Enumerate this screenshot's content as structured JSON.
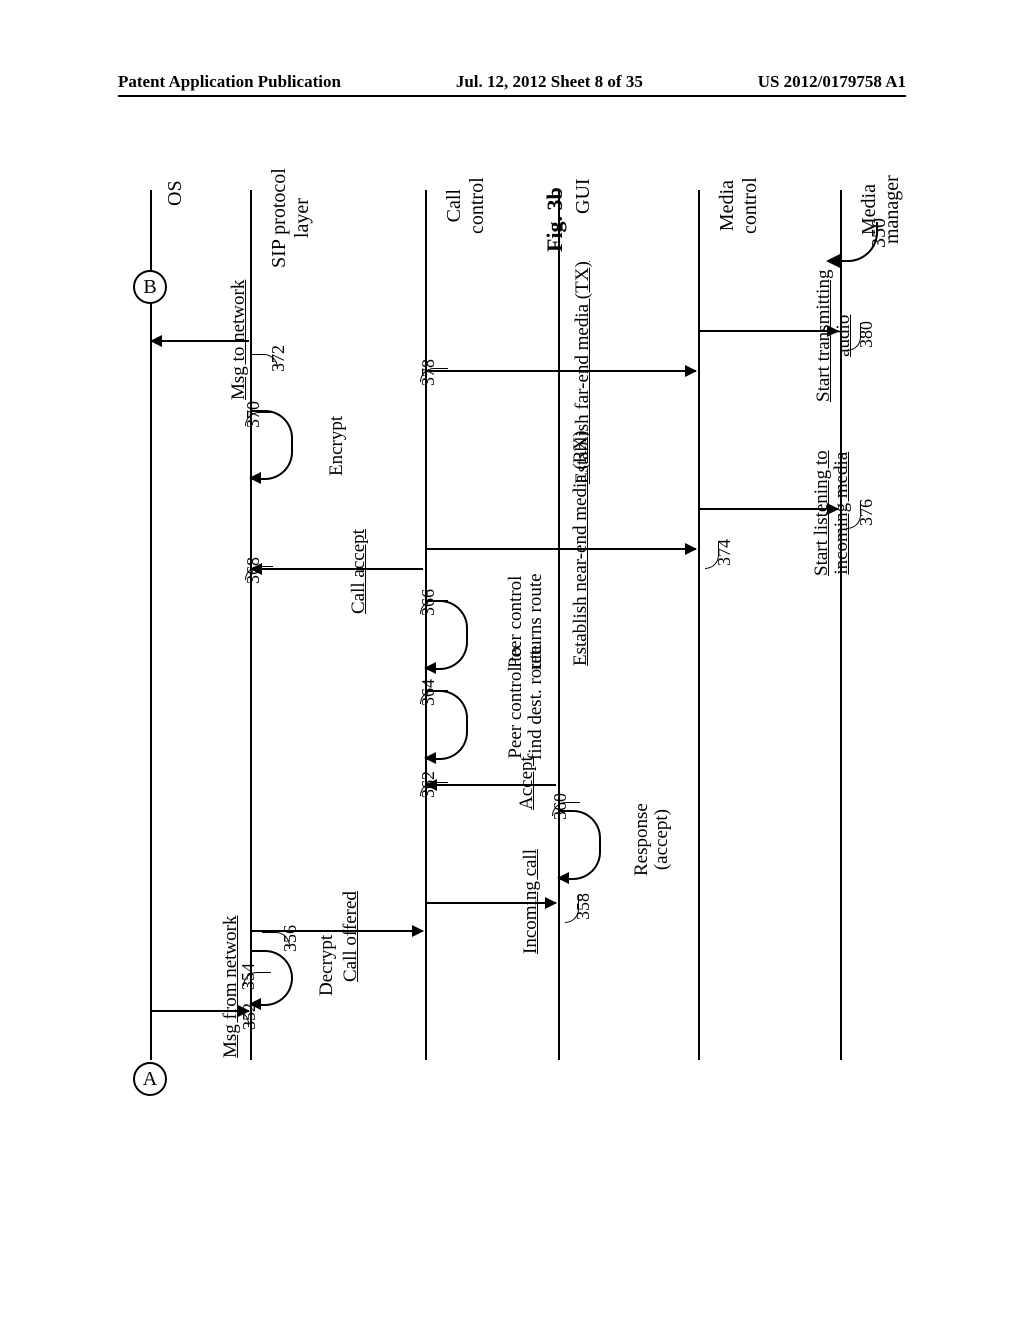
{
  "header": {
    "left": "Patent Application Publication",
    "center": "Jul. 12, 2012  Sheet 8 of 35",
    "right": "US 2012/0179758 A1"
  },
  "figure_label": "Fig. 3b",
  "diagram_ref": "350",
  "lifelines": {
    "os": "OS",
    "sip": "SIP protocol\nlayer",
    "call": "Call\ncontrol",
    "gui": "GUI",
    "mctrl": "Media\ncontrol",
    "mmgr": "Media\nmanager"
  },
  "circles": {
    "a": "A",
    "b": "B"
  },
  "messages": {
    "msg_from_network": "Msg from network",
    "decrypt": "Decrypt",
    "call_offered": "Call offered",
    "incoming_call": "Incoming call",
    "response_accept": "Response\n(accept)",
    "accept": "Accept",
    "peer_find": "Peer control to\nfind dest. route",
    "peer_returns": "Peer control\nreturns route",
    "call_accept": "Call accept",
    "encrypt": "Encrypt",
    "msg_to_network": "Msg to network",
    "near_end_rx": "Establish near-end media (RX)",
    "start_listen": "Start listening to\nincoming media",
    "far_end_tx": "Establish far-end media (TX)",
    "start_tx_audio": "Start transmitting\naudio"
  },
  "refs": {
    "r352": "352",
    "r354": "354",
    "r356": "356",
    "r358": "358",
    "r360": "360",
    "r362": "362",
    "r364": "364",
    "r366": "366",
    "r368": "368",
    "r370": "370",
    "r372": "372",
    "r374": "374",
    "r376": "376",
    "r378": "378",
    "r380": "380"
  }
}
